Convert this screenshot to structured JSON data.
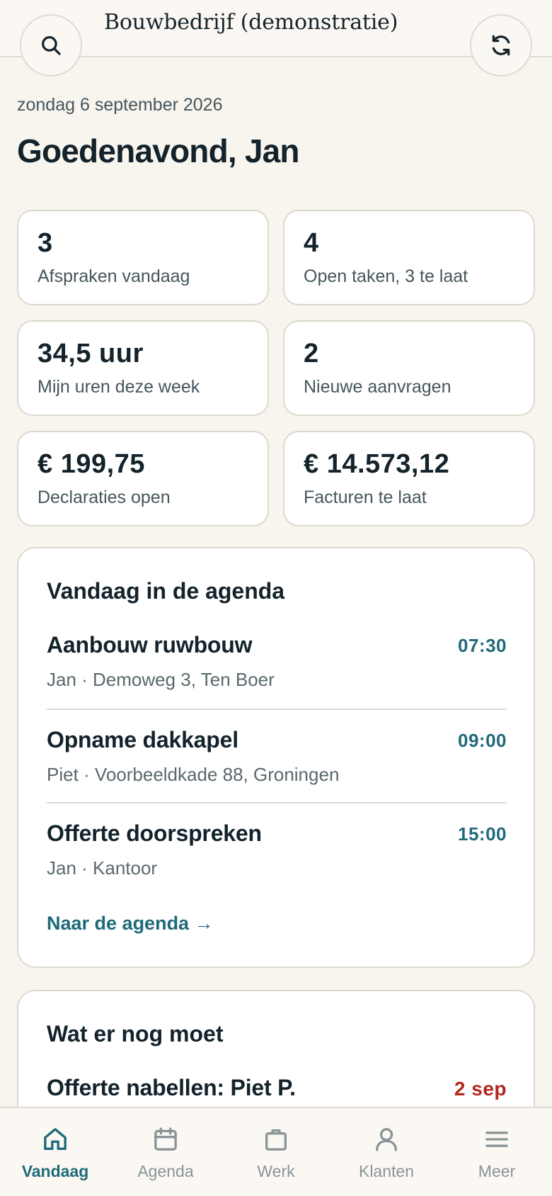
{
  "header": {
    "brand": "Bouwbedrijf (demonstratie)",
    "search_icon": "search-icon",
    "refresh_icon": "refresh-icon"
  },
  "date": "zondag 6 september 2026",
  "greeting": "Goedenavond, Jan",
  "stats": [
    {
      "value": "3",
      "label": "Afspraken vandaag"
    },
    {
      "value": "4",
      "label": "Open taken, 3 te laat"
    },
    {
      "value": "34,5 uur",
      "label": "Mijn uren deze week"
    },
    {
      "value": "2",
      "label": "Nieuwe aanvragen"
    },
    {
      "value": "€ 199,75",
      "label": "Declaraties open"
    },
    {
      "value": "€ 14.573,12",
      "label": "Facturen te laat"
    }
  ],
  "agenda": {
    "title": "Vandaag in de agenda",
    "items": [
      {
        "title": "Aanbouw ruwbouw",
        "time": "07:30",
        "sub": "Jan · Demoweg 3, Ten Boer"
      },
      {
        "title": "Opname dakkapel",
        "time": "09:00",
        "sub": "Piet · Voorbeeldkade 88, Groningen"
      },
      {
        "title": "Offerte doorspreken",
        "time": "15:00",
        "sub": "Jan · Kantoor"
      }
    ],
    "link": "Naar de agenda →"
  },
  "todo": {
    "title": "Wat er nog moet",
    "items": [
      {
        "title": "Offerte nabellen: Piet P.",
        "due": "2 sep"
      }
    ]
  },
  "nav": [
    {
      "label": "Vandaag",
      "icon": "home-icon",
      "active": true
    },
    {
      "label": "Agenda",
      "icon": "calendar-icon",
      "active": false
    },
    {
      "label": "Werk",
      "icon": "briefcase-icon",
      "active": false
    },
    {
      "label": "Klanten",
      "icon": "person-icon",
      "active": false
    },
    {
      "label": "Meer",
      "icon": "menu-icon",
      "active": false
    }
  ],
  "colors": {
    "accent": "#1f6a7a",
    "danger": "#b3261e",
    "background": "#f8f5ef",
    "card": "#ffffff"
  }
}
